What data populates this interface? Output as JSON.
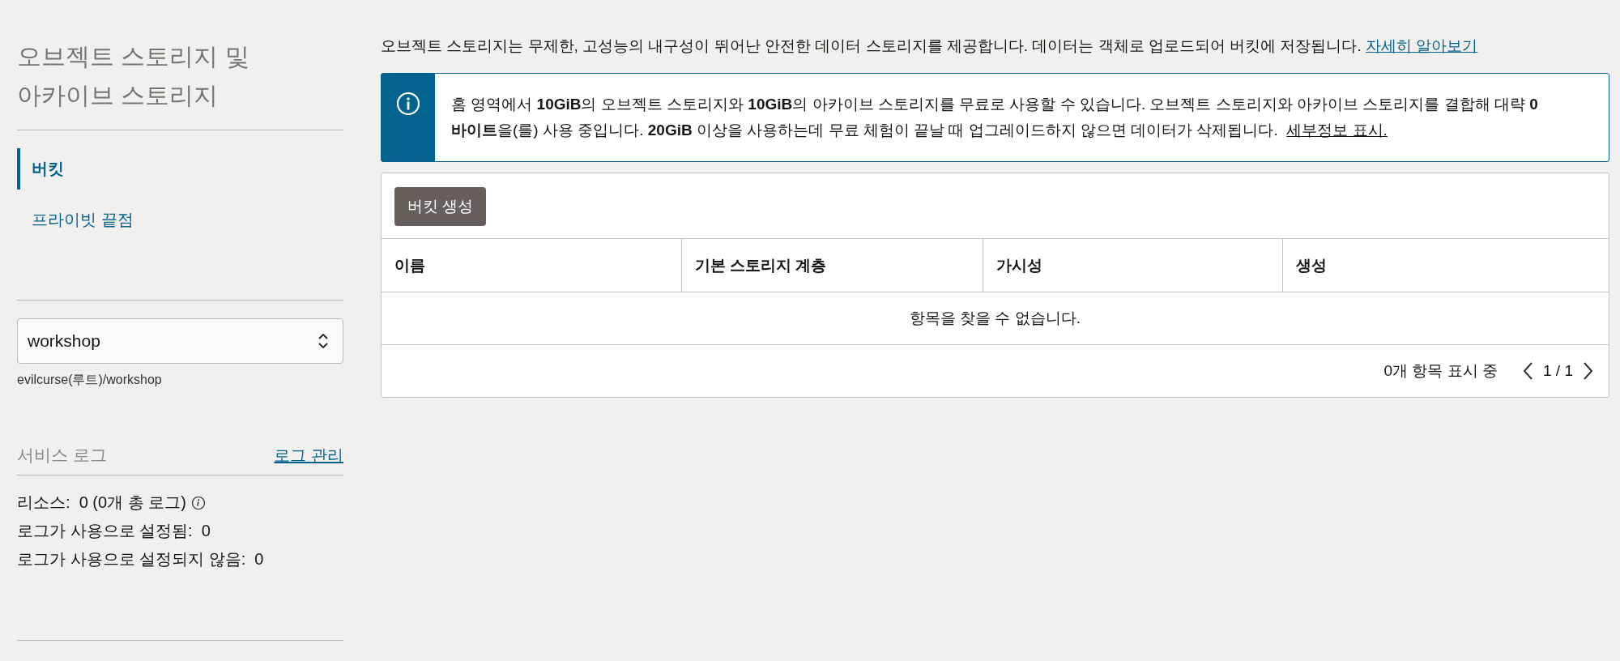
{
  "sidebar": {
    "title": "오브젝트 스토리지 및 아카이브 스토리지",
    "nav": [
      {
        "label": "버킷",
        "selected": true
      },
      {
        "label": "프라이빗 끝점",
        "selected": false
      }
    ],
    "compartment": {
      "value": "workshop",
      "path": "evilcurse(루트)/workshop"
    },
    "service_logs": {
      "title": "서비스 로그",
      "link": "로그 관리",
      "stats": [
        {
          "label": "리소스:",
          "value": "0 (0개 총 로그)",
          "info": true
        },
        {
          "label": "로그가 사용으로 설정됨:",
          "value": "0",
          "info": false
        },
        {
          "label": "로그가 사용으로 설정되지 않음:",
          "value": "0",
          "info": false
        }
      ]
    }
  },
  "intro": {
    "text": "오브젝트 스토리지는 무제한, 고성능의 내구성이 뛰어난 안전한 데이터 스토리지를 제공합니다. 데이터는 객체로 업로드되어 버킷에 저장됩니다.",
    "link": "자세히 알아보기"
  },
  "notice": {
    "text": "홈 영역에서 **10GiB**의 오브젝트 스토리지와 **10GiB**의 아카이브 스토리지를 무료로 사용할 수 있습니다. 오브젝트 스토리지와 아카이브 스토리지를 결합해 대략 **0 바이트**을(를) 사용 중입니다. **20GiB** 이상을 사용하는데 무료 체험이 끝날 때 업그레이드하지 않으면 데이터가 삭제됩니다.",
    "link": "세부정보 표시."
  },
  "table": {
    "create_button": "버킷 생성",
    "columns": [
      "이름",
      "기본 스토리지 계층",
      "가시성",
      "생성"
    ],
    "empty_message": "항목을 찾을 수 없습니다.",
    "footer": {
      "count": "0개 항목 표시 중",
      "page": "1 / 1"
    }
  }
}
